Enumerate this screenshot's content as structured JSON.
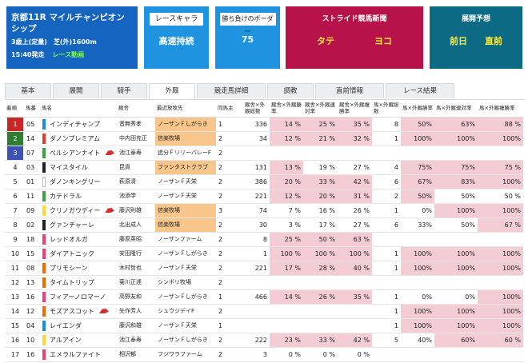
{
  "race": {
    "title": "京都11R マイルチャンピオンシップ",
    "cond": "3歳上(定量)　芝(外)1600m",
    "time": "15:40発走",
    "link": "レース動画"
  },
  "cards": {
    "chara": {
      "label": "レースキャラ",
      "value": "高速持続"
    },
    "border": {
      "label": "勝ち負けのボーダー",
      "value": "75"
    },
    "stride": {
      "label": "ストライド競馬新聞",
      "a": "タテ",
      "b": "ヨコ"
    },
    "tenkai": {
      "label": "展開予想",
      "a": "前日",
      "b": "直前"
    }
  },
  "tabs": [
    "基本",
    "展開",
    "騎手",
    "外厩",
    "競走馬詳細",
    "調教",
    "直前情報",
    "レース結果"
  ],
  "columns": [
    "着順",
    "馬番",
    "馬名",
    "厩舎",
    "最近放牧先",
    "同馬主",
    "厩舎×外厩総数",
    "厩舎×外厩勝率",
    "厩舎×外厩連対率",
    "厩舎×外厩複勝率",
    "馬×外厩総数",
    "馬×外厩勝率",
    "馬×外厩連対率",
    "馬×外厩複勝率"
  ],
  "colors": {
    "accent": "#1565c0",
    "pink": "#f3cdd3",
    "orange": "#f8c58a"
  },
  "rows": [
    {
      "rank": "1",
      "no": "05",
      "name": "インディチャンプ",
      "stable": "音無秀孝",
      "farm": "ノーザンＦしがらき",
      "same": "1",
      "tot": "336",
      "w": "14 %",
      "r": "25 %",
      "p": "35 %",
      "htot": "8",
      "hw": "50%",
      "hr": "63%",
      "hp": "88 %",
      "wc": "#c62828",
      "col": "#1e88e5",
      "cap": false
    },
    {
      "rank": "2",
      "no": "14",
      "name": "ダノンプレミアム",
      "stable": "中内田充正",
      "farm": "信楽牧場",
      "same": "2",
      "tot": "34",
      "w": "12 %",
      "r": "21 %",
      "p": "32 %",
      "htot": "1",
      "hw": "100%",
      "hr": "100%",
      "hp": "100%",
      "wc": "#2e7d32",
      "col": "#e53935",
      "cap": false
    },
    {
      "rank": "3",
      "no": "07",
      "name": "ペルシアンナイト",
      "stable": "池江泰寿",
      "farm": "追分ＦリリーバレーF",
      "same": "2",
      "tot": "",
      "w": "",
      "r": "",
      "p": "",
      "htot": "",
      "hw": "",
      "hr": "",
      "hp": "",
      "wc": "#3f51b5",
      "col": "#43a047",
      "cap": true
    },
    {
      "rank": "4",
      "no": "03",
      "name": "マイスタイル",
      "stable": "昆貢",
      "farm": "ファンタストクラブ",
      "same": "2",
      "tot": "131",
      "w": "13 %",
      "r": "19 %",
      "p": "27 %",
      "htot": "4",
      "hw": "75%",
      "hr": "75%",
      "hp": "75 %",
      "wc": "",
      "col": "#222",
      "cap": false
    },
    {
      "rank": "5",
      "no": "01",
      "name": "ダノンキングリー",
      "stable": "萩原清",
      "farm": "ノーザンＦ天栄",
      "same": "2",
      "tot": "386",
      "w": "20 %",
      "r": "33 %",
      "p": "42 %",
      "htot": "6",
      "hw": "67%",
      "hr": "83%",
      "hp": "100%",
      "wc": "",
      "col": "#ffffff",
      "cap": false
    },
    {
      "rank": "6",
      "no": "11",
      "name": "カテドラル",
      "stable": "池添学",
      "farm": "ノーザンＦ天栄",
      "same": "2",
      "tot": "221",
      "w": "12 %",
      "r": "20 %",
      "p": "31 %",
      "htot": "2",
      "hw": "50%",
      "hr": "50%",
      "hp": "50 %",
      "wc": "",
      "col": "#43a047",
      "cap": false
    },
    {
      "rank": "7",
      "no": "09",
      "name": "クリノガウディー",
      "stable": "藤沢則雄",
      "farm": "信楽牧場",
      "same": "3",
      "tot": "74",
      "w": "7 %",
      "r": "16 %",
      "p": "26 %",
      "htot": "1",
      "hw": "0%",
      "hr": "100%",
      "hp": "100%",
      "wc": "",
      "col": "#fdd835",
      "cap": true
    },
    {
      "rank": "8",
      "no": "02",
      "name": "グァンチャーレ",
      "stable": "北出成人",
      "farm": "信楽牧場",
      "same": "2",
      "tot": "30",
      "w": "3 %",
      "r": "17 %",
      "p": "27 %",
      "htot": "6",
      "hw": "33%",
      "hr": "50%",
      "hp": "67 %",
      "wc": "",
      "col": "#222",
      "cap": false
    },
    {
      "rank": "9",
      "no": "18",
      "name": "レッドオルガ",
      "stable": "藤原英昭",
      "farm": "ノーザンファーム",
      "same": "2",
      "tot": "8",
      "w": "25 %",
      "r": "50 %",
      "p": "63 %",
      "htot": "",
      "hw": "",
      "hr": "",
      "hp": "",
      "wc": "",
      "col": "#ec407a",
      "cap": false
    },
    {
      "rank": "10",
      "no": "15",
      "name": "ダイアトニック",
      "stable": "安田隆行",
      "farm": "ノーザンＦしがらき",
      "same": "2",
      "tot": "1",
      "w": "100 %",
      "r": "100 %",
      "p": "100 %",
      "htot": "1",
      "hw": "100%",
      "hr": "100%",
      "hp": "100%",
      "wc": "",
      "col": "#ec407a",
      "cap": false
    },
    {
      "rank": "11",
      "no": "08",
      "name": "プリモシーン",
      "stable": "木村哲也",
      "farm": "ノーザンＦ天栄",
      "same": "2",
      "tot": "221",
      "w": "17 %",
      "r": "28 %",
      "p": "40 %",
      "htot": "1",
      "hw": "100%",
      "hr": "100%",
      "hp": "100%",
      "wc": "",
      "col": "#ef6c00",
      "cap": false
    },
    {
      "rank": "12",
      "no": "13",
      "name": "タイムトリップ",
      "stable": "菊川正達",
      "farm": "シンボリ牧場",
      "same": "2",
      "tot": "",
      "w": "",
      "r": "",
      "p": "",
      "htot": "",
      "hw": "",
      "hr": "",
      "hp": "",
      "wc": "",
      "col": "#ef6c00",
      "cap": false
    },
    {
      "rank": "13",
      "no": "16",
      "name": "フィアーノロマーノ",
      "stable": "高野友和",
      "farm": "ノーザンＦしがらき",
      "same": "1",
      "tot": "466",
      "w": "14 %",
      "r": "26 %",
      "p": "35 %",
      "htot": "1",
      "hw": "0%",
      "hr": "0%",
      "hp": "100%",
      "wc": "",
      "col": "#ec407a",
      "cap": false
    },
    {
      "rank": "14",
      "no": "12",
      "name": "モズアスコット",
      "stable": "矢作芳人",
      "farm": "シュウジデイF",
      "same": "2",
      "tot": "",
      "w": "",
      "r": "",
      "p": "",
      "htot": "1",
      "hw": "100%",
      "hr": "100%",
      "hp": "100%",
      "wc": "",
      "col": "#ef6c00",
      "cap": true
    },
    {
      "rank": "15",
      "no": "04",
      "name": "レイエンダ",
      "stable": "藤沢和雄",
      "farm": "ノーザンＦ天栄",
      "same": "1",
      "tot": "",
      "w": "",
      "r": "",
      "p": "",
      "htot": "1",
      "hw": "100%",
      "hr": "100%",
      "hp": "100%",
      "wc": "",
      "col": "#1e88e5",
      "cap": false
    },
    {
      "rank": "16",
      "no": "10",
      "name": "アルアイン",
      "stable": "池江泰寿",
      "farm": "ノーザンＦしがらき",
      "same": "2",
      "tot": "222",
      "w": "23 %",
      "r": "33 %",
      "p": "42 %",
      "htot": "5",
      "hw": "40%",
      "hr": "60%",
      "hp": "60 %",
      "wc": "",
      "col": "#fdd835",
      "cap": false
    },
    {
      "rank": "17",
      "no": "16",
      "name": "エメラルファイト",
      "stable": "相沢郁",
      "farm": "フジワラファーム",
      "same": "2",
      "tot": "3",
      "w": "0 %",
      "r": "0 %",
      "p": "0 %",
      "htot": "",
      "hw": "",
      "hr": "",
      "hp": "",
      "wc": "",
      "col": "#ec407a",
      "cap": false
    }
  ]
}
